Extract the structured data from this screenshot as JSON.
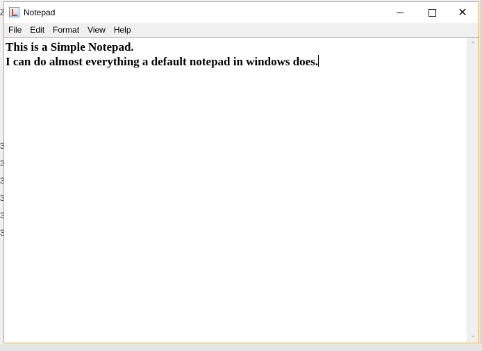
{
  "window": {
    "title": "Notepad",
    "app_icon": "notepad-java-icon",
    "controls": {
      "minimize_icon": "minimize-icon",
      "maximize_icon": "maximize-icon",
      "close_icon": "close-icon",
      "close_glyph": "✕"
    },
    "accent_border_color": "#e3a21a"
  },
  "menu": {
    "items": [
      {
        "label": "File"
      },
      {
        "label": "Edit"
      },
      {
        "label": "Format"
      },
      {
        "label": "View"
      },
      {
        "label": "Help"
      }
    ]
  },
  "editor": {
    "line1": "This is a Simple Notepad.",
    "line2": "I can do almost everything a default notepad in windows does."
  },
  "scrollbar": {
    "up_glyph": "⌃",
    "down_glyph": "⌄"
  },
  "background": {
    "mark_top": "Z",
    "mark_side": "3"
  }
}
